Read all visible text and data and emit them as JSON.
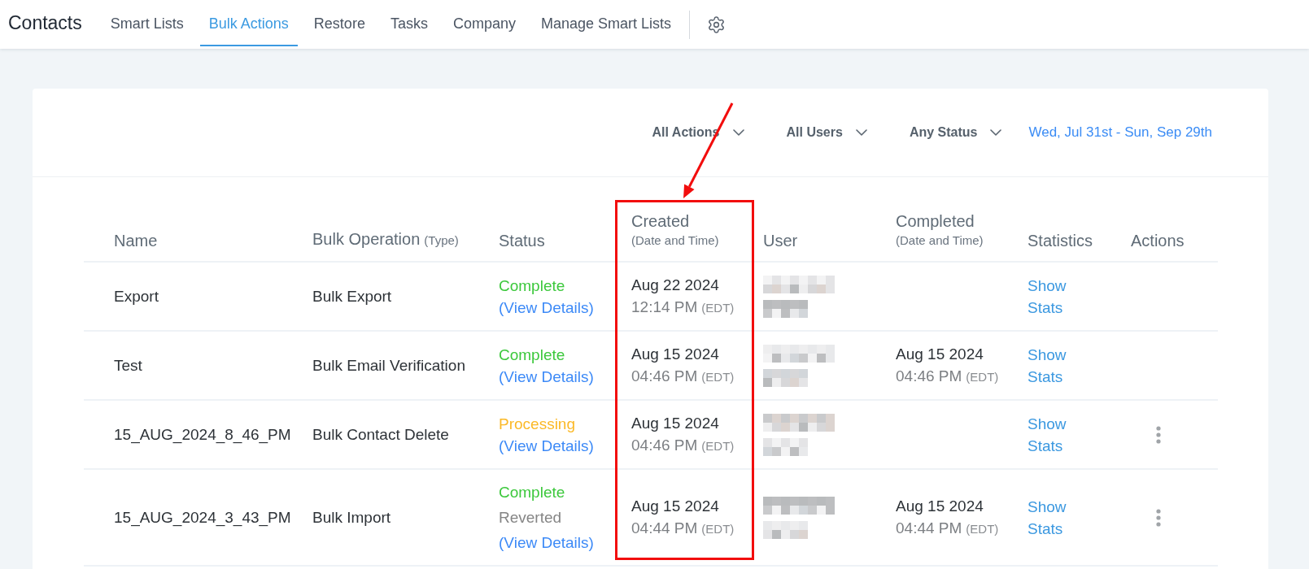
{
  "app": {
    "title": "Contacts"
  },
  "tabs": [
    {
      "label": "Smart Lists",
      "selected": false
    },
    {
      "label": "Bulk Actions",
      "selected": true
    },
    {
      "label": "Restore",
      "selected": false
    },
    {
      "label": "Tasks",
      "selected": false
    },
    {
      "label": "Company",
      "selected": false
    },
    {
      "label": "Manage Smart Lists",
      "selected": false
    }
  ],
  "filters": [
    {
      "label": "All Actions"
    },
    {
      "label": "All Users"
    },
    {
      "label": "Any Status"
    }
  ],
  "date_range": "Wed, Jul 31st - Sun, Sep 29th",
  "table": {
    "columns": [
      {
        "label": "Name",
        "highlighted": false
      },
      {
        "label": "Bulk Operation",
        "hint": "(Type)",
        "highlighted": false
      },
      {
        "label": "Status",
        "highlighted": false
      },
      {
        "label": "Created",
        "subtitle": "(Date and Time)",
        "highlighted": true
      },
      {
        "label": "User",
        "highlighted": false
      },
      {
        "label": "Completed",
        "subtitle": "(Date and Time)",
        "highlighted": false
      },
      {
        "label": "Statistics",
        "highlighted": false
      },
      {
        "label": "Actions",
        "highlighted": false
      }
    ],
    "rows": [
      {
        "name": "Export",
        "operation": "Bulk Export",
        "status": [
          {
            "label": "Complete",
            "kind": "complete"
          }
        ],
        "details_link": "(View Details)",
        "created": {
          "date": "Aug 22 2024",
          "time": "12:14 PM",
          "zone": "(EDT)"
        },
        "stats_link": "Show Stats",
        "has_menu": false
      },
      {
        "name": "Test",
        "operation": "Bulk Email Verification",
        "status": [
          {
            "label": "Complete",
            "kind": "complete"
          }
        ],
        "details_link": "(View Details)",
        "created": {
          "date": "Aug 15 2024",
          "time": "04:46 PM",
          "zone": "(EDT)"
        },
        "completed": {
          "date": "Aug 15 2024",
          "time": "04:46 PM",
          "zone": "(EDT)"
        },
        "stats_link": "Show Stats",
        "has_menu": false
      },
      {
        "name": "15_AUG_2024_8_46_PM",
        "operation": "Bulk Contact Delete",
        "status": [
          {
            "label": "Processing",
            "kind": "processing"
          }
        ],
        "details_link": "(View Details)",
        "created": {
          "date": "Aug 15 2024",
          "time": "04:46 PM",
          "zone": "(EDT)"
        },
        "stats_link": "Show Stats",
        "has_menu": true
      },
      {
        "name": "15_AUG_2024_3_43_PM",
        "operation": "Bulk Import",
        "status": [
          {
            "label": "Complete",
            "kind": "complete"
          },
          {
            "label": "Reverted",
            "kind": "reverted"
          }
        ],
        "details_link": "(View Details)",
        "created": {
          "date": "Aug 15 2024",
          "time": "04:44 PM",
          "zone": "(EDT)"
        },
        "completed": {
          "date": "Aug 15 2024",
          "time": "04:44 PM",
          "zone": "(EDT)"
        },
        "stats_link": "Show Stats",
        "has_menu": true
      }
    ]
  }
}
